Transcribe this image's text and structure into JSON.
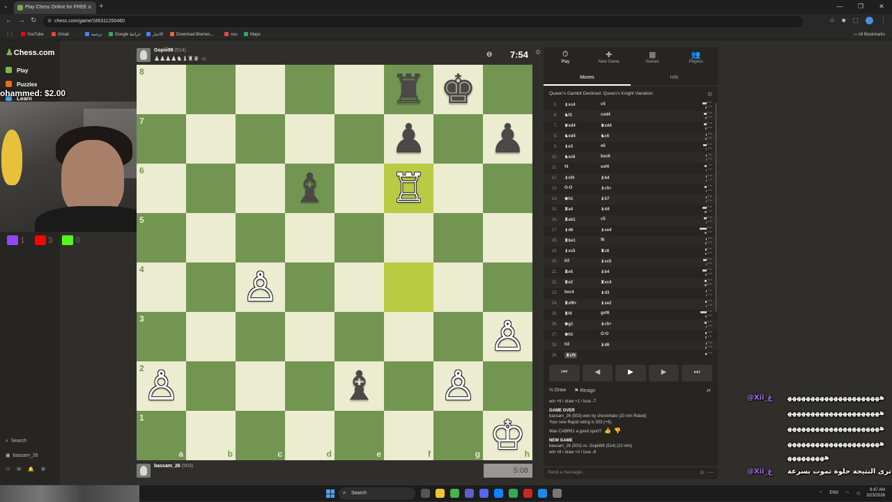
{
  "browser": {
    "tab_title": "Play Chess Online for FREE",
    "url": "chess.com/game/166311250460",
    "bookmarks": [
      "YouTube",
      "Gmail",
      "ترجمة",
      "Google خرائط",
      "الأخبار",
      "Download Biomes...",
      "xuu",
      "Maps"
    ],
    "all_bookmarks": "All Bookmarks"
  },
  "sidebar": {
    "logo": "Chess.com",
    "items": [
      {
        "label": "Play",
        "icon": "play-icon",
        "color": "#81b64c"
      },
      {
        "label": "Puzzles",
        "icon": "puzzles-icon",
        "color": "#e86e1a"
      },
      {
        "label": "Learn",
        "icon": "learn-icon",
        "color": "#4aa3df"
      }
    ],
    "search": "Search",
    "user": "bassam_26"
  },
  "overlay": {
    "donation": "ohammed: $2.00",
    "socials": [
      {
        "platform": "twitch",
        "count": "1",
        "color": "#9146ff"
      },
      {
        "platform": "youtube",
        "count": "3",
        "color": "#ff0000"
      },
      {
        "platform": "kick",
        "count": "0",
        "color": "#53fc18"
      }
    ]
  },
  "game": {
    "top_player": {
      "name": "Gopiii98",
      "rating": "(514)",
      "captured": "♟♟♟♟♞♝♜♛",
      "material": "+5",
      "clock": "7:54"
    },
    "bottom_player": {
      "name": "bassam_26",
      "rating": "(503)",
      "clock": "5:08"
    },
    "files": [
      "a",
      "b",
      "c",
      "d",
      "e",
      "f",
      "g",
      "h"
    ],
    "ranks": [
      "8",
      "7",
      "6",
      "5",
      "4",
      "3",
      "2",
      "1"
    ],
    "highlight_squares": [
      "f6",
      "f4"
    ],
    "pieces": [
      {
        "sq": "f8",
        "glyph": "♜",
        "color": "b",
        "name": "black-rook"
      },
      {
        "sq": "g8",
        "glyph": "♚",
        "color": "b",
        "name": "black-king"
      },
      {
        "sq": "f7",
        "glyph": "♟",
        "color": "b",
        "name": "black-pawn"
      },
      {
        "sq": "h7",
        "glyph": "♟",
        "color": "b",
        "name": "black-pawn"
      },
      {
        "sq": "d6",
        "glyph": "♝",
        "color": "b",
        "name": "black-bishop"
      },
      {
        "sq": "f6",
        "glyph": "♖",
        "color": "w",
        "name": "white-rook"
      },
      {
        "sq": "c4",
        "glyph": "♙",
        "color": "w",
        "name": "white-pawn"
      },
      {
        "sq": "h3",
        "glyph": "♙",
        "color": "w",
        "name": "white-pawn"
      },
      {
        "sq": "a2",
        "glyph": "♙",
        "color": "w",
        "name": "white-pawn"
      },
      {
        "sq": "e2",
        "glyph": "♝",
        "color": "b",
        "name": "black-bishop"
      },
      {
        "sq": "g2",
        "glyph": "♙",
        "color": "w",
        "name": "white-pawn"
      },
      {
        "sq": "h1",
        "glyph": "♔",
        "color": "w",
        "name": "white-king"
      }
    ]
  },
  "panel": {
    "tabs": [
      {
        "label": "Play",
        "icon": "⏱"
      },
      {
        "label": "New Game",
        "icon": "✚"
      },
      {
        "label": "Games",
        "icon": "▦"
      },
      {
        "label": "Players",
        "icon": "👥"
      }
    ],
    "subtabs": [
      "Moves",
      "Info"
    ],
    "opening": "Queen's Gambit Declined: Queen's Knight Variation",
    "moves": [
      {
        "n": "5.",
        "w": "♝xc4",
        "b": "c5",
        "t1": "30.1s",
        "t2": "3.7s",
        "f1": 6,
        "f2": 2
      },
      {
        "n": "6.",
        "w": "♞f3",
        "b": "cxd4",
        "t1": "12.9s",
        "t2": "2.6s",
        "f1": 4,
        "f2": 2
      },
      {
        "n": "7.",
        "w": "♛xd4",
        "b": "♛xd4",
        "t1": "12.3s",
        "t2": "5.3s",
        "f1": 4,
        "f2": 2
      },
      {
        "n": "8.",
        "w": "♞xd4",
        "b": "♞c6",
        "t1": "1.5s",
        "t2": "3.8s",
        "f1": 1,
        "f2": 2
      },
      {
        "n": "9.",
        "w": "♝e3",
        "b": "e5",
        "t1": "15.5s",
        "t2": "2.3s",
        "f1": 5,
        "f2": 1
      },
      {
        "n": "10.",
        "w": "♞xc6",
        "b": "bxc6",
        "t1": "1.6s",
        "t2": "2.0s",
        "f1": 1,
        "f2": 1
      },
      {
        "n": "11.",
        "w": "f4",
        "b": "exf4",
        "t1": "7.2s",
        "t2": "1.9s",
        "f1": 3,
        "f2": 1
      },
      {
        "n": "12.",
        "w": "♝xf4",
        "b": "♝b4",
        "t1": "3.1s",
        "t2": "1.7s",
        "f1": 1,
        "f2": 1
      },
      {
        "n": "13.",
        "w": "O-O",
        "b": "♝c5+",
        "t1": "7.6s",
        "t2": "1.5s",
        "f1": 3,
        "f2": 1
      },
      {
        "n": "14.",
        "w": "♚h1",
        "b": "♝b7",
        "t1": "3.5s",
        "t2": "2.3s",
        "f1": 1,
        "f2": 1
      },
      {
        "n": "15.",
        "w": "♜a4",
        "b": "♝d4",
        "t1": "18.9s",
        "t2": "7.7s",
        "f1": 6,
        "f2": 3
      },
      {
        "n": "16.",
        "w": "♜ab1",
        "b": "c5",
        "t1": "12.3s",
        "t2": "3.2s",
        "f1": 4,
        "f2": 1
      },
      {
        "n": "17.",
        "w": "♝d6",
        "b": "♝xe4",
        "t1": "26.5s",
        "t2": "9.5s",
        "f1": 10,
        "f2": 3
      },
      {
        "n": "18.",
        "w": "♜be1",
        "b": "f6",
        "t1": "3.0s",
        "t2": "5.3s",
        "f1": 1,
        "f2": 2
      },
      {
        "n": "19.",
        "w": "♝xc5",
        "b": "♜c8",
        "t1": "6.8s",
        "t2": "5.2s",
        "f1": 2,
        "f2": 2
      },
      {
        "n": "20.",
        "w": "b3",
        "b": "♝xc5",
        "t1": "16.5s",
        "t2": "2.5s",
        "f1": 5,
        "f2": 1
      },
      {
        "n": "21.",
        "w": "♜e5",
        "b": "♝b4",
        "t1": "17.6s",
        "t2": "4.3s",
        "f1": 6,
        "f2": 2
      },
      {
        "n": "22.",
        "w": "♜e2",
        "b": "♜xc4",
        "t1": "8.7s",
        "t2": "10.0s",
        "f1": 3,
        "f2": 3
      },
      {
        "n": "23.",
        "w": "bxc4",
        "b": "♝d3",
        "t1": "2.2s",
        "t2": "1.7s",
        "f1": 1,
        "f2": 1
      },
      {
        "n": "24.",
        "w": "♜xf6+",
        "b": "♝xe2",
        "t1": "4.2s",
        "t2": "1.5s",
        "f1": 2,
        "f2": 1
      },
      {
        "n": "25.",
        "w": "♜f4",
        "b": "gxf6",
        "t1": "27.1s",
        "t2": "5.4s",
        "f1": 9,
        "f2": 2
      },
      {
        "n": "26.",
        "w": "♚g1",
        "b": "♝c5+",
        "t1": "8.2s",
        "t2": "2.4s",
        "f1": 3,
        "f2": 1
      },
      {
        "n": "27.",
        "w": "♚h1",
        "b": "O-O",
        "t1": "5.8s",
        "t2": "4.3s",
        "f1": 2,
        "f2": 2
      },
      {
        "n": "28.",
        "w": "h3",
        "b": "♝d6",
        "t1": "2.6s",
        "t2": "3.7s",
        "f1": 1,
        "f2": 2
      },
      {
        "n": "29.",
        "w": "♜xf6",
        "b": "",
        "t1": "4.4s",
        "t2": "",
        "f1": 2,
        "f2": 0
      }
    ],
    "nav_buttons": [
      "⏮",
      "◀",
      "▶",
      "▶",
      "⏭"
    ],
    "actions": {
      "draw": "Draw",
      "resign": "Resign"
    },
    "chat": {
      "stats1": "win +9 / draw +1 / lose -7",
      "game_over": "GAME OVER",
      "result": "bassam_26 (503) won by checkmate (10 min Rated)",
      "rating": "Your new Rapid rating is 503 (+9).",
      "sport": "Was CABR61 a good sport?",
      "new_game": "NEW GAME",
      "match": "bassam_26 (503) vs. Gopiii98 (514) (10 min)",
      "stats2": "win +8 / draw +0 / lose -8"
    },
    "send_placeholder": "Send a message..."
  },
  "stream_chat": {
    "user": "@Xii_ڠ",
    "lines": [
      "ﻫﻬﻬﻬﻬﻬﻬﻬﻬﻬﻬﻬﻬﻬﻬﻬﻬﻬﻬﻬﻬ",
      "ﻫﻬﻬﻬﻬﻬﻬﻬﻬﻬﻬﻬﻬﻬﻬﻬﻬﻬﻬﻬﻬ",
      "ﻫﻬﻬﻬﻬﻬﻬﻬﻬﻬﻬﻬﻬﻬﻬﻬﻬﻬﻬﻬﻬ",
      "ﻫﻬﻬﻬﻬﻬﻬﻬﻬﻬﻬﻬﻬﻬﻬﻬﻬﻬﻬﻬﻬ",
      "ﻫﻬﻬﻬﻬﻬﻬﻬﻬ"
    ],
    "user2": "@Xii_ڠ",
    "message2": "ترى النتيجة حلوة تموت بسرعة"
  },
  "taskbar": {
    "search": "Search",
    "lang": "ENG",
    "time": "9:47 AM",
    "date": "3/23/2026"
  }
}
